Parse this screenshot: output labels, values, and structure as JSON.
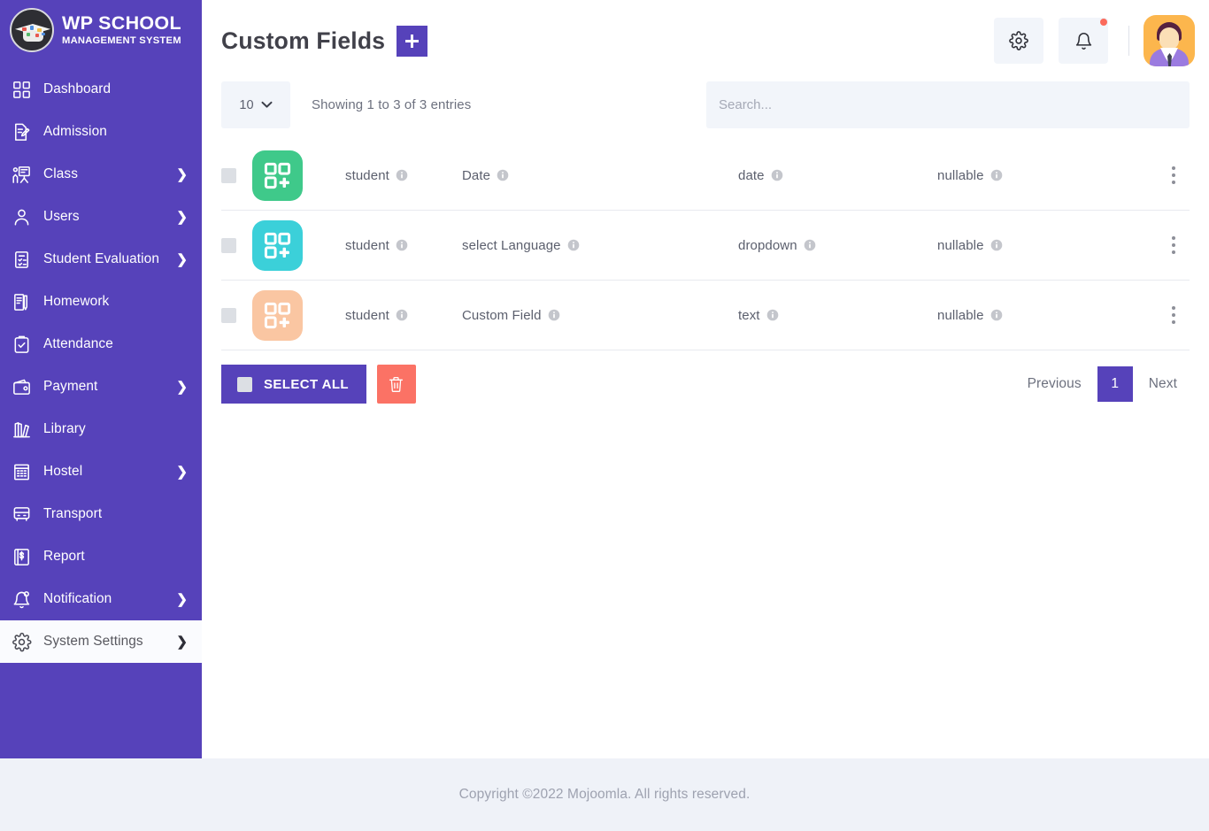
{
  "brand": {
    "logo_icon": "graduation-cap-logo",
    "title": "WP SCHOOL",
    "subtitle": "MANAGEMENT SYSTEM"
  },
  "sidebar": {
    "items": [
      {
        "label": "Dashboard",
        "icon": "grid-icon",
        "expandable": false,
        "active": false
      },
      {
        "label": "Admission",
        "icon": "document-pen-icon",
        "expandable": false,
        "active": false
      },
      {
        "label": "Class",
        "icon": "classroom-icon",
        "expandable": true,
        "active": false
      },
      {
        "label": "Users",
        "icon": "user-icon",
        "expandable": true,
        "active": false
      },
      {
        "label": "Student Evaluation",
        "icon": "clipboard-check-icon",
        "expandable": true,
        "active": false
      },
      {
        "label": "Homework",
        "icon": "book-pen-icon",
        "expandable": false,
        "active": false
      },
      {
        "label": "Attendance",
        "icon": "clipboard-tick-icon",
        "expandable": false,
        "active": false
      },
      {
        "label": "Payment",
        "icon": "wallet-icon",
        "expandable": true,
        "active": false
      },
      {
        "label": "Library",
        "icon": "books-icon",
        "expandable": false,
        "active": false
      },
      {
        "label": "Hostel",
        "icon": "building-icon",
        "expandable": true,
        "active": false
      },
      {
        "label": "Transport",
        "icon": "bus-icon",
        "expandable": false,
        "active": false
      },
      {
        "label": "Report",
        "icon": "report-icon",
        "expandable": false,
        "active": false
      },
      {
        "label": "Notification",
        "icon": "bell-icon",
        "expandable": true,
        "active": false
      },
      {
        "label": "System Settings",
        "icon": "gear-icon",
        "expandable": true,
        "active": true
      }
    ],
    "expand_arrow": "❯"
  },
  "header": {
    "title": "Custom Fields",
    "add_button_icon": "plus-icon",
    "settings_button_icon": "gear-icon",
    "notifications_button_icon": "bell-icon",
    "notification_badge": true,
    "avatar_icon": "user-avatar"
  },
  "toolbar": {
    "page_length": "10",
    "page_length_caret": "chevron-down-icon",
    "entries_info": "Showing 1 to 3 of 3 entries",
    "search_placeholder": "Search...",
    "search_value": ""
  },
  "table": {
    "rows": [
      {
        "icon": "custom-field-add-icon",
        "icon_color": "#3fc98a",
        "module": "student",
        "field_label": "Date",
        "field_type": "date",
        "validation": "nullable",
        "menu_icon": "kebab-menu-icon",
        "checked": false
      },
      {
        "icon": "custom-field-add-icon",
        "icon_color": "#3bd0d9",
        "module": "student",
        "field_label": "select Language",
        "field_type": "dropdown",
        "validation": "nullable",
        "menu_icon": "kebab-menu-icon",
        "checked": false
      },
      {
        "icon": "custom-field-add-icon",
        "icon_color": "#fac6a2",
        "module": "student",
        "field_label": "Custom Field",
        "field_type": "text",
        "validation": "nullable",
        "menu_icon": "kebab-menu-icon",
        "checked": false
      }
    ],
    "info_icon": "info-icon"
  },
  "actions": {
    "select_all_label": "SELECT ALL",
    "delete_icon": "trash-icon"
  },
  "pagination": {
    "previous_label": "Previous",
    "current_page": "1",
    "next_label": "Next"
  },
  "footer": {
    "copyright": "Copyright ©2022 Mojoomla. All rights reserved."
  },
  "colors": {
    "brand_purple": "#5642ba",
    "danger_red": "#fb7265",
    "muted_bg": "#f2f5fa",
    "footer_bg": "#eff2f8"
  }
}
